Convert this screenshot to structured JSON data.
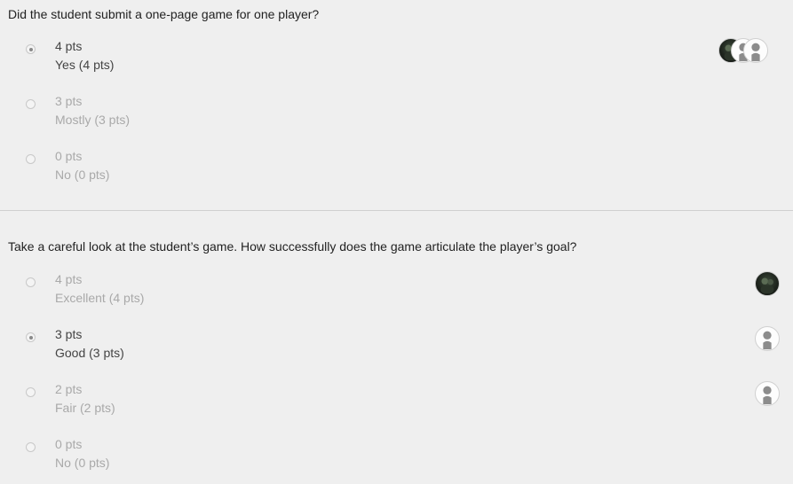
{
  "questions": [
    {
      "prompt": "Did the student submit a one-page game for one player?",
      "options": [
        {
          "points": "4 pts",
          "label": "Yes (4 pts)",
          "selected": true
        },
        {
          "points": "3 pts",
          "label": "Mostly (3 pts)",
          "selected": false
        },
        {
          "points": "0 pts",
          "label": "No (0 pts)",
          "selected": false
        }
      ],
      "graders": [
        "photo-avatar",
        "default-avatar",
        "default-avatar"
      ]
    },
    {
      "prompt": "Take a careful look at the student’s game. How successfully does the game articulate the player’s goal?",
      "options": [
        {
          "points": "4 pts",
          "label": "Excellent (4 pts)",
          "selected": false,
          "grader": "photo-avatar"
        },
        {
          "points": "3 pts",
          "label": "Good (3 pts)",
          "selected": true,
          "grader": "default-avatar"
        },
        {
          "points": "2 pts",
          "label": "Fair (2 pts)",
          "selected": false,
          "grader": "default-avatar"
        },
        {
          "points": "0 pts",
          "label": "No (0 pts)",
          "selected": false
        }
      ]
    }
  ]
}
